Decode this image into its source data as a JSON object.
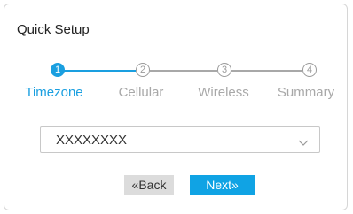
{
  "dialog": {
    "title": "Quick Setup"
  },
  "steps": [
    {
      "number": "1",
      "label": "Timezone",
      "state": "active"
    },
    {
      "number": "2",
      "label": "Cellular",
      "state": "inactive"
    },
    {
      "number": "3",
      "label": "Wireless",
      "state": "inactive"
    },
    {
      "number": "4",
      "label": "Summary",
      "state": "inactive"
    }
  ],
  "timezone_select": {
    "value": "XXXXXXXX"
  },
  "buttons": {
    "back_label": "«Back",
    "next_label": "Next»"
  },
  "colors": {
    "accent": "#1a9fe0",
    "next_button": "#10a3e4",
    "back_button": "#dcdcdc",
    "inactive": "#9a9a9a"
  },
  "icons": {
    "select_arrow": "chevron-down-icon"
  }
}
